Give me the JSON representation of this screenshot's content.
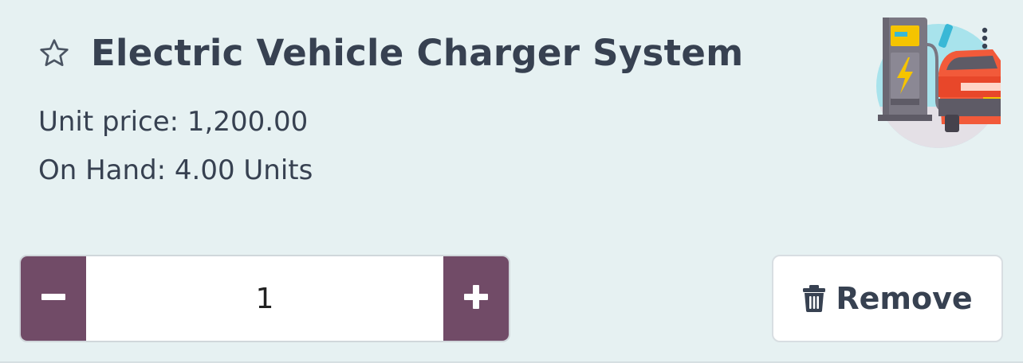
{
  "product": {
    "name": "Electric Vehicle Charger System",
    "unit_price_label": "Unit price: 1,200.00",
    "on_hand_label": "On Hand: 4.00 Units",
    "image_icon": "ev-charger-car-icon"
  },
  "quantity": {
    "value": "1",
    "decrease_icon": "minus-icon",
    "increase_icon": "plus-icon"
  },
  "remove_button": {
    "label": "Remove",
    "icon": "trash-icon"
  },
  "colors": {
    "background": "#e6f1f2",
    "accent": "#714b67",
    "text": "#374151"
  }
}
